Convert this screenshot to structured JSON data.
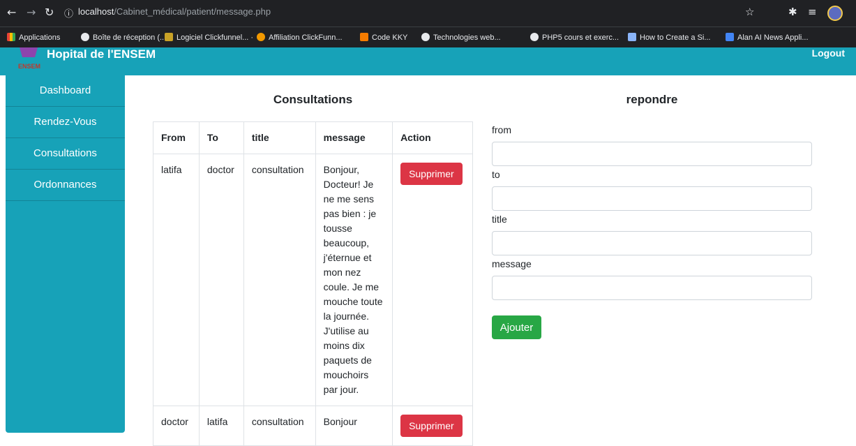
{
  "browser": {
    "url_host": "localhost",
    "url_path": "/Cabinet_médical/patient/message.php",
    "bookmarks": [
      "Applications",
      "Boîte de réception (...",
      "Logiciel Clickfunnel... ·",
      "Affiliation ClickFunn...",
      "Code KKY",
      "Technologies web...",
      "PHP5 cours et exerc...",
      "How to Create a Si...",
      "Alan AI News Appli..."
    ]
  },
  "header": {
    "brand": "Hopital de l'ENSEM",
    "logo_text": "ENSEM",
    "logout": "Logout"
  },
  "sidebar": {
    "items": [
      "Dashboard",
      "Rendez-Vous",
      "Consultations",
      "Ordonnances"
    ]
  },
  "consultations": {
    "title": "Consultations",
    "columns": [
      "From",
      "To",
      "title",
      "message",
      "Action"
    ],
    "rows": [
      {
        "from": "latifa",
        "to": "doctor",
        "title": "consultation",
        "message": "Bonjour, Docteur! Je ne me sens pas bien : je tousse beaucoup, j'éternue et mon nez coule. Je me mouche toute la journée. J'utilise au moins dix paquets de mouchoirs par jour.",
        "action": "Supprimer"
      },
      {
        "from": "doctor",
        "to": "latifa",
        "title": "consultation",
        "message": "Bonjour",
        "action": "Supprimer"
      }
    ]
  },
  "reply": {
    "title": "repondre",
    "labels": {
      "from": "from",
      "to": "to",
      "title": "title",
      "message": "message"
    },
    "submit": "Ajouter"
  }
}
